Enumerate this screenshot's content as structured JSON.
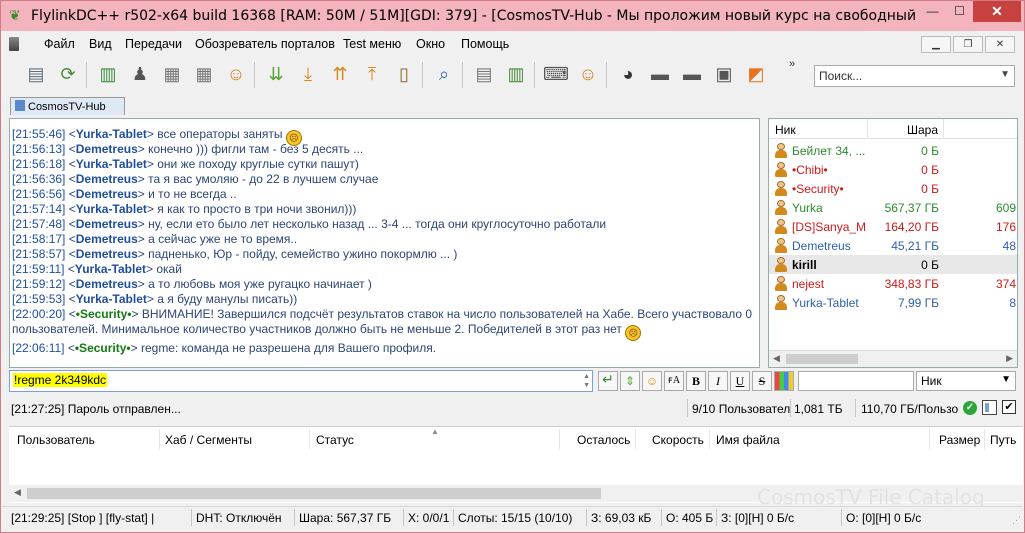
{
  "window": {
    "title": "FlylinkDC++ r502-x64 build 16368 [RAM: 50M / 51M][GDI: 379] - [CosmosTV-Hub - Мы проложим новый курс на свободный Оре..."
  },
  "menu": {
    "items": [
      "Файл",
      "Вид",
      "Передачи",
      "Обозреватель порталов",
      "Test меню",
      "Окно",
      "Помощь"
    ]
  },
  "toolbar": {
    "search_placeholder": "Поиск...",
    "more": "»"
  },
  "hub_tab": {
    "label": "CosmosTV-Hub"
  },
  "chat": {
    "lines": [
      {
        "ts": "[21:55:46]",
        "nick": "Yurka-Tablet",
        "text": "все операторы заняты",
        "smiley": true
      },
      {
        "ts": "[21:56:13]",
        "nick": "Demetreus",
        "text": "конечно ))) фигли там - без 5 десять ..."
      },
      {
        "ts": "[21:56:18]",
        "nick": "Yurka-Tablet",
        "text": "они же походу круглые сутки пашут)"
      },
      {
        "ts": "[21:56:36]",
        "nick": "Demetreus",
        "text": "та я вас умоляю - до 22 в лучшем случае"
      },
      {
        "ts": "[21:56:56]",
        "nick": "Demetreus",
        "text": "и то не всегда .."
      },
      {
        "ts": "[21:57:14]",
        "nick": "Yurka-Tablet",
        "text": "я как то просто в три ночи звонил)))"
      },
      {
        "ts": "[21:57:48]",
        "nick": "Demetreus",
        "text": "ну, если ето было лет несколько назад ... 3-4 ... тогда они круглосуточно работали"
      },
      {
        "ts": "[21:58:17]",
        "nick": "Demetreus",
        "text": "а сейчас уже не то время.."
      },
      {
        "ts": "[21:58:57]",
        "nick": "Demetreus",
        "text": "падненько, Юр - пойду, семейство ужино покормлю ... )"
      },
      {
        "ts": "[21:59:11]",
        "nick": "Yurka-Tablet",
        "text": "окай"
      },
      {
        "ts": "[21:59:12]",
        "nick": "Demetreus",
        "text": "а то любовь моя уже ругацко начинает )"
      },
      {
        "ts": "[21:59:53]",
        "nick": "Yurka-Tablet",
        "text": "а я буду манулы писать))"
      }
    ],
    "security_1": {
      "ts": "[22:00:20]",
      "nick": "•Security•",
      "text": "ВНИМАНИЕ! Завершился подсчёт результатов ставок на число пользователей на Хабе. Всего участвовало 0 пользователей. Минимальное количество участников должно быть не меньше 2. Победителей в этот раз нет"
    },
    "security_2": {
      "ts": "[22:06:11]",
      "nick": "•Security•",
      "text": "regme: команда не разрешена для Вашего профиля."
    }
  },
  "userlist": {
    "col_nick": "Ник",
    "col_share": "Шара",
    "users": [
      {
        "name": "Бейлет 34, ...",
        "share": "0 Б",
        "extra": "",
        "color": "#2e8b2e"
      },
      {
        "name": "•Chibi•",
        "share": "0 Б",
        "extra": "",
        "color": "#d01818"
      },
      {
        "name": "•Security•",
        "share": "0 Б",
        "extra": "",
        "color": "#d01818"
      },
      {
        "name": "Yurka",
        "share": "567,37 ГБ",
        "extra": "609",
        "color": "#2e8b2e"
      },
      {
        "name": "[DS]Sanya_M",
        "share": "164,20 ГБ",
        "extra": "176",
        "color": "#d01818"
      },
      {
        "name": "Demetreus",
        "share": "45,21 ГБ",
        "extra": "48",
        "color": "#2e5fa8"
      },
      {
        "name": "kirill",
        "share": "0 Б",
        "extra": "",
        "color": "#000000"
      },
      {
        "name": "nejest",
        "share": "348,83 ГБ",
        "extra": "374",
        "color": "#d01818"
      },
      {
        "name": "Yurka-Tablet",
        "share": "7,99 ГБ",
        "extra": "8",
        "color": "#2e5fa8"
      }
    ]
  },
  "input": {
    "message": "!regme 2k349kdc",
    "nick_combo": "Ник"
  },
  "hub_status": {
    "message": "[21:27:25] Пароль отправлен...",
    "users": "9/10 Пользовател",
    "share_per": "1,081 ТБ",
    "share_avg": "110,70 ГБ/Пользо"
  },
  "transfers": {
    "columns": [
      "Пользователь",
      "Хаб / Сегменты",
      "Статус",
      "Осталось",
      "Скорость",
      "Имя файла",
      "Размер",
      "Путь"
    ],
    "watermark": "CosmosTV File Catalog"
  },
  "statusbar": {
    "log": "[21:29:25] [Stop ] [fly-stat] |",
    "dht": "DHT: Отключён",
    "share": "Шара: 567,37 ГБ",
    "x": "X: 0/0/1",
    "slots": "Слоты: 15/15 (10/10)",
    "down": "З: 69,03 кБ",
    "up": "О: 405 Б",
    "down_rate": "З: [0][Н] 0 Б/с",
    "up_rate": "О: [0][Н] 0 Б/с"
  }
}
